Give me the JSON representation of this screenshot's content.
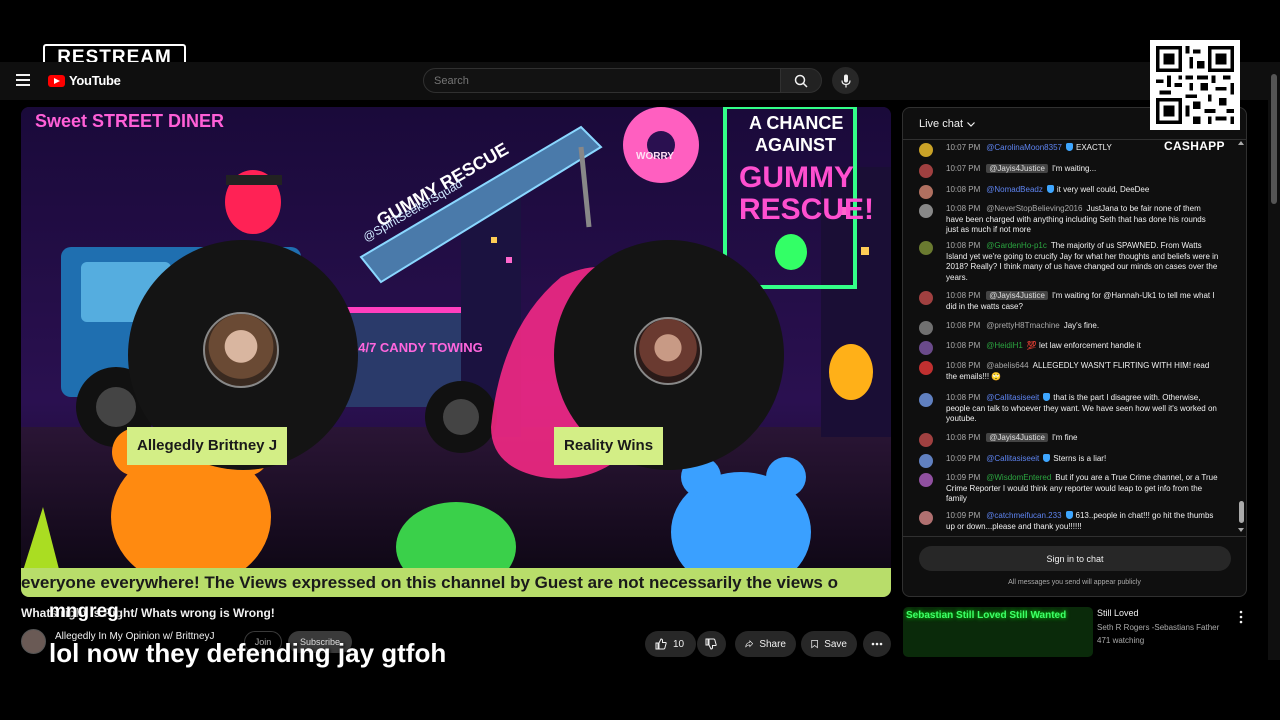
{
  "restream": {
    "label": "RESTREAM"
  },
  "youtube": {
    "logo_text": "YouTube",
    "sign_in_peek": "in"
  },
  "search": {
    "placeholder": "Search"
  },
  "qr": {
    "caption": "CASHAPP"
  },
  "video": {
    "ticker": "everyone everywhere! The Views expressed on this channel by Guest are not necessarily the views o",
    "guests": [
      {
        "name": "Allegedly Brittney J"
      },
      {
        "name": "Reality Wins"
      }
    ],
    "title": "Whats right is Right/ Whats wrong is Wrong!",
    "channel_name": "Allegedly In My Opinion w/ BrittneyJ",
    "join_label": "Join",
    "subscribe_label": "Subscribe",
    "like_count": "10",
    "share_label": "Share",
    "save_label": "Save",
    "poster_name": "mngreg",
    "poster_comment": "lol now they defending jay gtfoh",
    "scene_text": {
      "diner": "Sweet STREET DINER",
      "truck": "GUMMY RESCUE",
      "handle": "@SpiritSeekerSquad",
      "towing": "24/7 CANDY TOWING",
      "sign1": "A CHANCE",
      "sign2": "AGAINST",
      "sign3": "GUMMY",
      "sign4": "RESCUE!",
      "donut": "WORRY"
    }
  },
  "chat": {
    "header": "Live chat",
    "messages": [
      {
        "time": "10:07 PM",
        "author": "@CarolinaMoon8357",
        "type": "mod",
        "text": "EXACTLY",
        "color": "#c9a227"
      },
      {
        "time": "10:07 PM",
        "author": "@Jayis4Justice",
        "type": "tag",
        "text": "I'm waiting...",
        "color": "#a04040"
      },
      {
        "time": "10:08 PM",
        "author": "@NomadBeadz",
        "type": "mod",
        "text": "it very well could, DeeDee",
        "color": "#b07060"
      },
      {
        "time": "10:08 PM",
        "author": "@NeverStopBelieving2016",
        "type": "plain",
        "text": "JustJana to be fair none of them have been charged with anything including Seth that has done his rounds just as much if not more",
        "color": "#888888"
      },
      {
        "time": "10:08 PM",
        "author": "@GardenHo-p1c",
        "type": "member",
        "text": "The majority of us SPAWNED. From Watts Island yet we're going to crucify Jay for what her thoughts and beliefs were in 2018? Really? I think many of us have changed our minds on cases over the years.",
        "color": "#6a7a30"
      },
      {
        "time": "10:08 PM",
        "author": "@Jayis4Justice",
        "type": "tag",
        "text": "I'm waiting for @Hannah-Uk1 to tell me what I did in the watts case?",
        "color": "#a04040"
      },
      {
        "time": "10:08 PM",
        "author": "@prettyH8Tmachine",
        "type": "plain",
        "text": "Jay's fine.",
        "color": "#707070"
      },
      {
        "time": "10:08 PM",
        "author": "@HeidiH1",
        "type": "member",
        "text": "💯 let law enforcement handle it",
        "color": "#6a4a8a"
      },
      {
        "time": "10:08 PM",
        "author": "@abelis644",
        "type": "plain",
        "text": "ALLEGEDLY WASN'T FLIRTING WITH HIM! read the emails!!! 🙄",
        "color": "#c03030"
      },
      {
        "time": "10:08 PM",
        "author": "@Callitasiseeit",
        "type": "mod",
        "text": "that is the part I disagree with. Otherwise, people can talk to whoever they want. We have seen how well it's worked on youtube.",
        "color": "#6080c0"
      },
      {
        "time": "10:08 PM",
        "author": "@Jayis4Justice",
        "type": "tag",
        "text": "I'm fine",
        "color": "#a04040"
      },
      {
        "time": "10:09 PM",
        "author": "@Callitasiseeit",
        "type": "mod",
        "text": "Sterns is a liar!",
        "color": "#6080c0"
      },
      {
        "time": "10:09 PM",
        "author": "@WisdomEntered",
        "type": "member",
        "text": "But if you are a True Crime channel, or a True Crime Reporter I would think any reporter would leap to get info from the family",
        "color": "#9050a0"
      },
      {
        "time": "10:09 PM",
        "author": "@catchmeifucan.233",
        "type": "mod",
        "text": "613..people in chat!!! go hit the thumbs up or down...please and thank you!!!!!!",
        "color": "#b07070"
      }
    ],
    "signin_label": "Sign in to chat",
    "note": "All messages you send will appear publicly"
  },
  "recommended": {
    "thumb_text": "Sebastian Still Loved Still Wanted",
    "title": "Still Loved",
    "channel": "Seth R Rogers -Sebastians Father",
    "views": "471 watching"
  },
  "colors": {
    "accent": "#3ea6ff",
    "ticker": "#b8dd6a",
    "label": "#d3ee86",
    "youtube_red": "#ff0000"
  }
}
